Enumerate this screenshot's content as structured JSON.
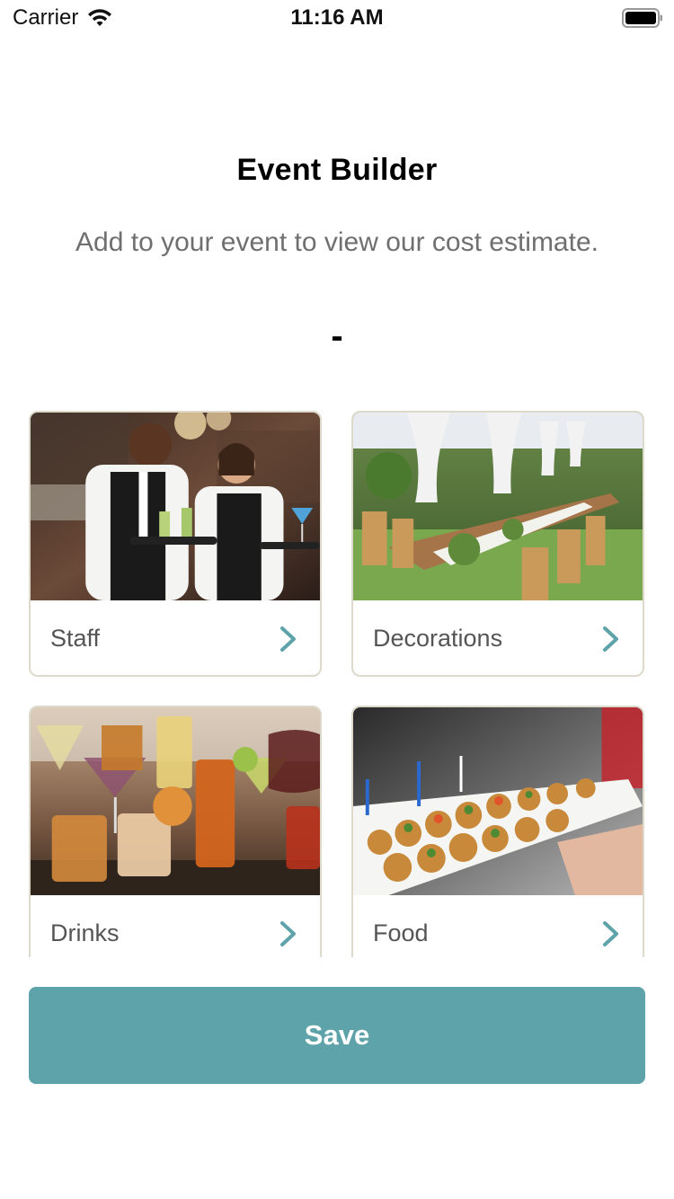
{
  "status_bar": {
    "carrier": "Carrier",
    "time": "11:16 AM",
    "icons": [
      "wifi-icon",
      "battery-icon"
    ]
  },
  "header": {
    "title": "Event Builder",
    "subtitle": "Add to your event to view our cost estimate.",
    "estimate": "-"
  },
  "cards": [
    {
      "label": "Staff",
      "image": "waiters-serving-drinks-photo",
      "icon": "chevron-right-icon"
    },
    {
      "label": "Decorations",
      "image": "outdoor-banquet-table-photo",
      "icon": "chevron-right-icon"
    },
    {
      "label": "Drinks",
      "image": "cocktails-on-bar-photo",
      "icon": "chevron-right-icon"
    },
    {
      "label": "Food",
      "image": "appetizer-platter-photo",
      "icon": "chevron-right-icon"
    }
  ],
  "actions": {
    "save_label": "Save"
  },
  "colors": {
    "accent": "#5fa3aa",
    "card_border": "#ddd9cb",
    "subtitle_text": "#6f6f6f",
    "card_label_text": "#555555"
  }
}
